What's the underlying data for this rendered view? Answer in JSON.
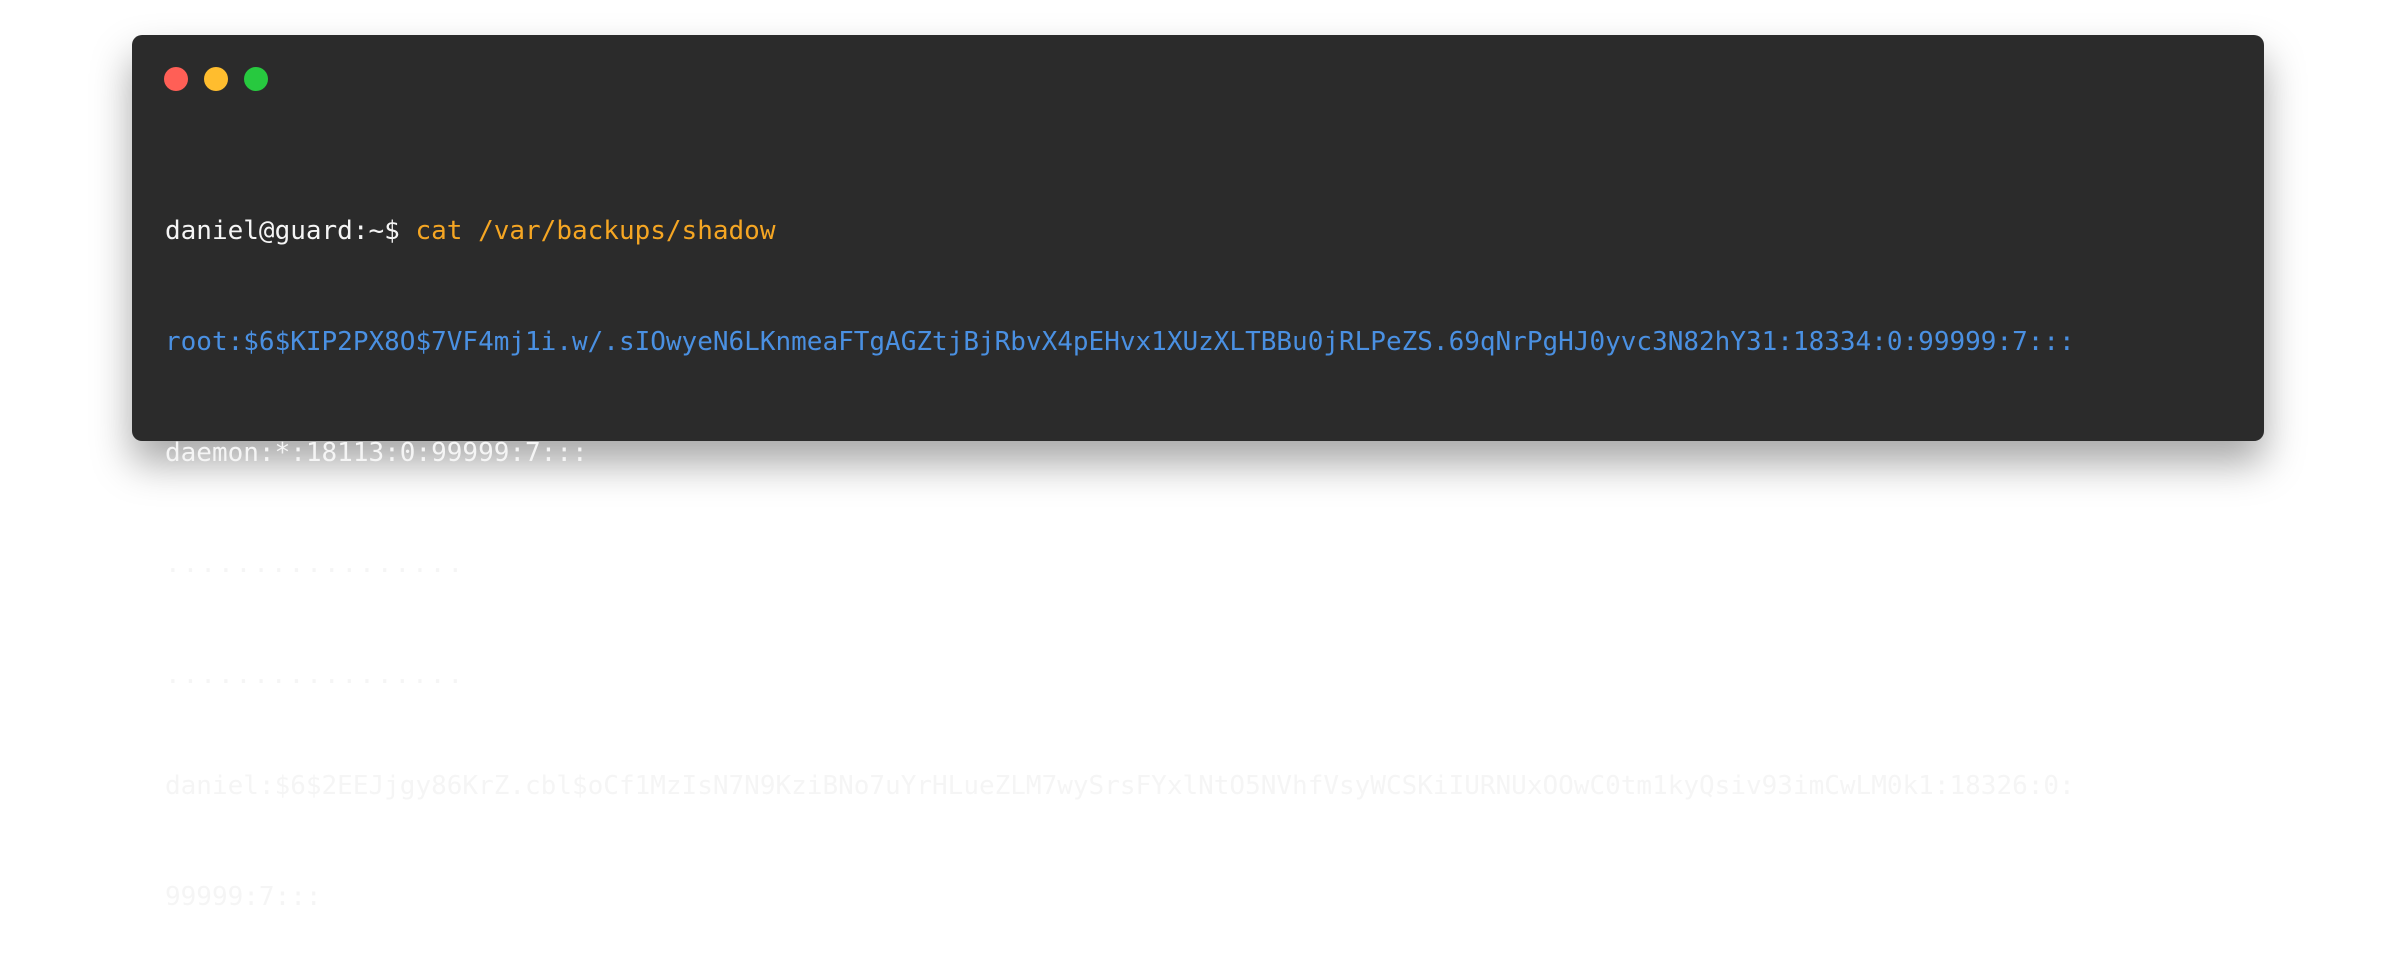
{
  "window": {
    "controls": [
      "close",
      "minimize",
      "maximize"
    ],
    "colors": {
      "background": "#2b2b2b",
      "close": "#ff5f56",
      "minimize": "#ffbd2e",
      "maximize": "#27c93f",
      "command": "#f5a623",
      "highlight": "#4a90e2",
      "text": "#f5f5f5"
    }
  },
  "terminal": {
    "prompt": "daniel@guard:~$ ",
    "command": "cat /var/backups/shadow",
    "lines": {
      "root": "root:$6$KIP2PX8O$7VF4mj1i.w/.sIOwyeN6LKnmeaFTgAGZtjBjRbvX4pEHvx1XUzXLTBBu0jRLPeZS.69qNrPgHJ0yvc3N82hY31:18334:0:99999:7:::",
      "daemon": "daemon:*:18113:0:99999:7:::",
      "dots_1": ".................",
      "dots_2": ".................",
      "daniel_part1": "daniel:$6$2EEJjgy86KrZ.cbl$oCf1MzIsN7N9KziBNo7uYrHLueZLM7wySrsFYxlNtO5NVhfVsyWCSKiIURNUxOOwC0tm1kyQsiv93imCwLM0k1:18326:0:",
      "daniel_part2": "99999:7:::"
    }
  }
}
